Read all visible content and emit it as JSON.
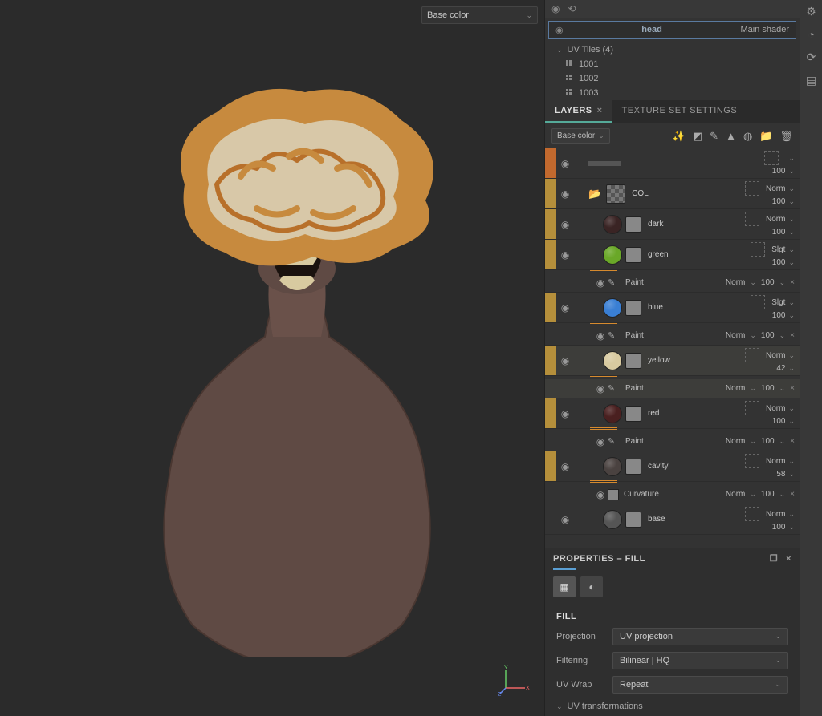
{
  "viewport": {
    "channel_dropdown": "Base color"
  },
  "textureSet": {
    "name": "head",
    "shader": "Main shader",
    "uvTilesLabel": "UV Tiles (4)",
    "tiles": [
      "1001",
      "1002",
      "1003"
    ]
  },
  "tabs": {
    "layers": "LAYERS",
    "textureSettings": "TEXTURE SET SETTINGS"
  },
  "layerPanel": {
    "channel": "Base color"
  },
  "layers": [
    {
      "type": "strip",
      "stripColor": "#c2692e",
      "blend": "",
      "opacity": "100"
    },
    {
      "type": "folder",
      "stripColor": "#b58f3b",
      "name": "COL",
      "blend": "Norm",
      "opacity": "100"
    },
    {
      "type": "fill",
      "stripColor": "#b58f3b",
      "name": "dark",
      "sphere": "#3a2424",
      "blend": "Norm",
      "opacity": "100"
    },
    {
      "type": "fill",
      "stripColor": "#b58f3b",
      "name": "green",
      "sphere": "#6aa828",
      "blend": "Slgt",
      "opacity": "100",
      "sub": {
        "type": "paint",
        "name": "Paint",
        "blend": "Norm",
        "opacity": "100"
      }
    },
    {
      "type": "fill",
      "stripColor": "#b58f3b",
      "name": "blue",
      "sphere": "#3a7fd4",
      "blend": "Slgt",
      "opacity": "100",
      "sub": {
        "type": "paint",
        "name": "Paint",
        "blend": "Norm",
        "opacity": "100"
      }
    },
    {
      "type": "fill",
      "stripColor": "#b58f3b",
      "name": "yellow",
      "sphere": "#d8caa0",
      "blend": "Norm",
      "opacity": "42",
      "selected": true,
      "sub": {
        "type": "paint",
        "name": "Paint",
        "blend": "Norm",
        "opacity": "100"
      }
    },
    {
      "type": "fill",
      "stripColor": "#b58f3b",
      "name": "red",
      "sphere": "#4a2020",
      "blend": "Norm",
      "opacity": "100",
      "sub": {
        "type": "paint",
        "name": "Paint",
        "blend": "Norm",
        "opacity": "100"
      }
    },
    {
      "type": "fill",
      "stripColor": "#b58f3b",
      "name": "cavity",
      "sphere": "#4a4240",
      "blend": "Norm",
      "opacity": "58",
      "sub": {
        "type": "curvature",
        "name": "Curvature",
        "blend": "Norm",
        "opacity": "100"
      }
    },
    {
      "type": "fill",
      "stripColor": "",
      "name": "base",
      "sphere": "#555",
      "blend": "Norm",
      "opacity": "100"
    }
  ],
  "properties": {
    "title": "PROPERTIES – FILL",
    "fill": "FILL",
    "projectionLabel": "Projection",
    "projectionValue": "UV projection",
    "filteringLabel": "Filtering",
    "filteringValue": "Bilinear | HQ",
    "uvWrapLabel": "UV Wrap",
    "uvWrapValue": "Repeat",
    "uvTransformations": "UV transformations"
  }
}
